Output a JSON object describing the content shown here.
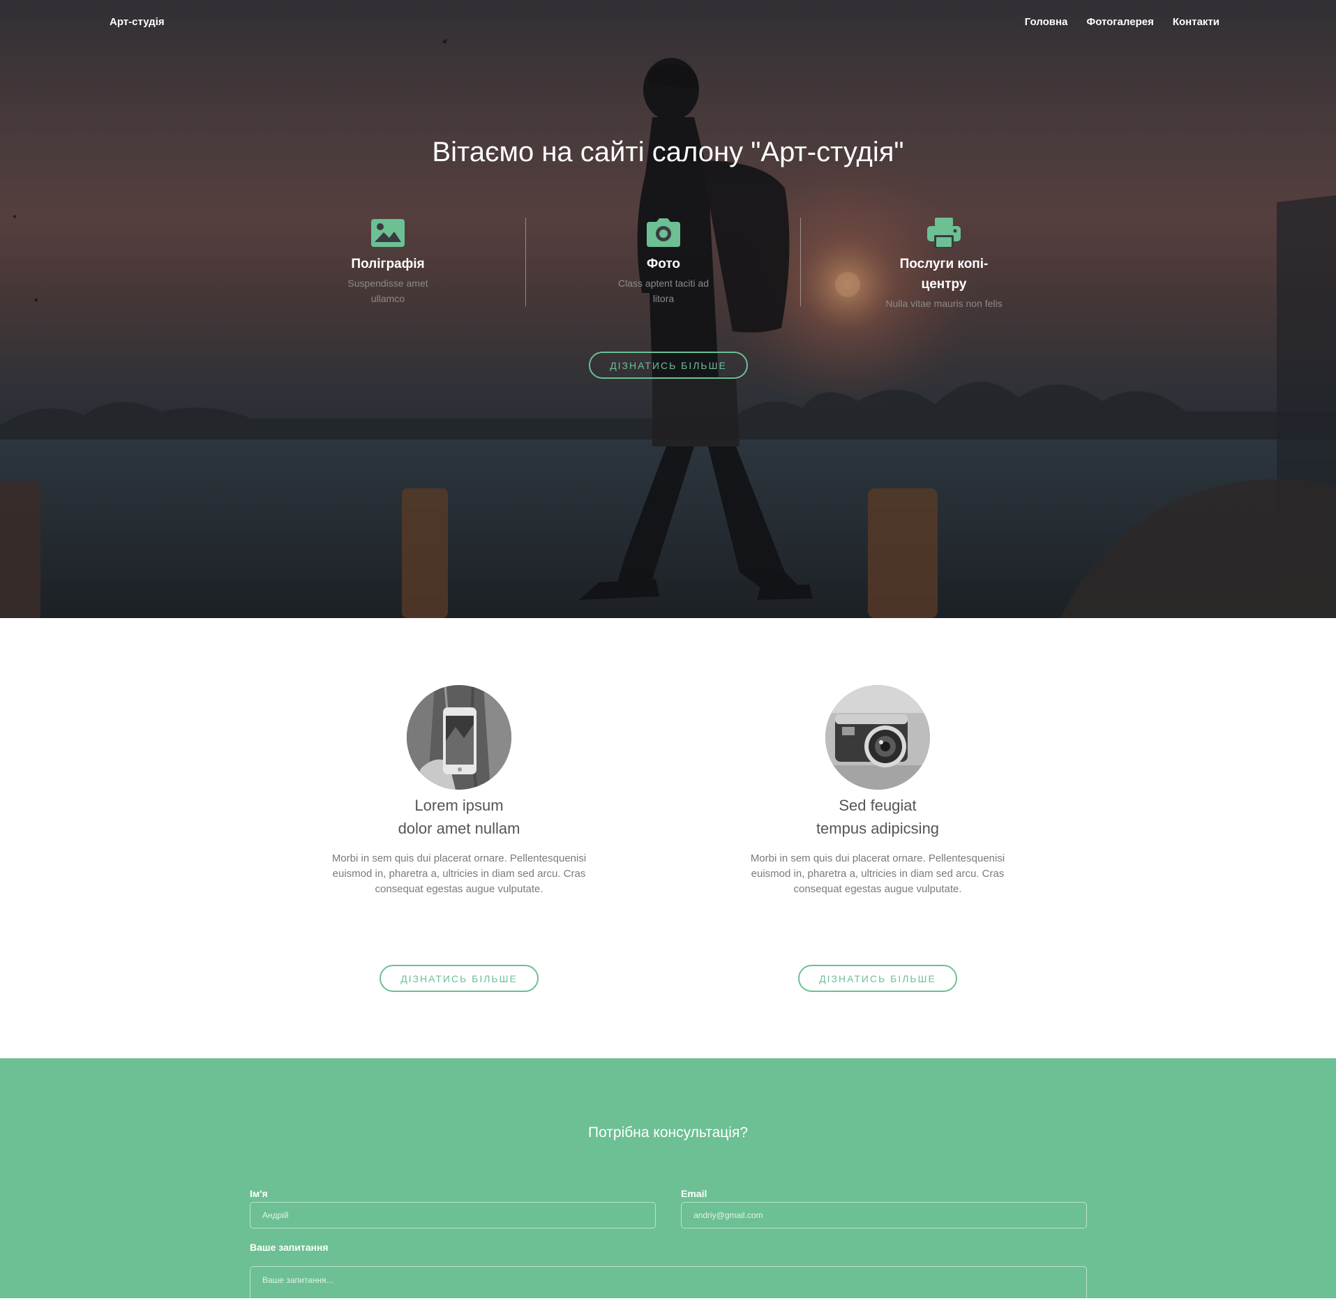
{
  "nav": {
    "brand": "Арт-студія",
    "links": [
      "Головна",
      "Фотогалерея",
      "Контакти"
    ]
  },
  "hero": {
    "title": "Вітаємо на сайті салону \"Арт-студія\"",
    "features": [
      {
        "icon": "image-icon",
        "title": "Поліграфія",
        "text": "Suspendisse amet ullamco"
      },
      {
        "icon": "camera-icon",
        "title": "Фото",
        "text": "Class aptent taciti ad litora"
      },
      {
        "icon": "printer-icon",
        "title": "Послуги копі-центру",
        "text": "Nulla vitae mauris non felis"
      }
    ],
    "button": "ДІЗНАТИСЬ БІЛЬШЕ"
  },
  "services": [
    {
      "image": "phone-photo",
      "title_line1": "Lorem ipsum",
      "title_line2": "dolor amet nullam",
      "text": "Morbi in sem quis dui placerat ornare. Pellentesquenisi euismod in, pharetra a, ultricies in diam sed arcu. Cras consequat egestas augue vulputate.",
      "button": "ДІЗНАТИСЬ БІЛЬШЕ"
    },
    {
      "image": "camera-photo",
      "title_line1": "Sed feugiat",
      "title_line2": "tempus adipicsing",
      "text": "Morbi in sem quis dui placerat ornare. Pellentesquenisi euismod in, pharetra a, ultricies in diam sed arcu. Cras consequat egestas augue vulputate.",
      "button": "ДІЗНАТИСЬ БІЛЬШЕ"
    }
  ],
  "contact": {
    "title": "Потрібна консультація?",
    "name_label": "Ім'я",
    "name_placeholder": "Андрій",
    "email_label": "Email",
    "email_placeholder": "andriy@gmail.com",
    "question_label": "Ваше запитання",
    "question_placeholder": "Ваше запитання..."
  },
  "colors": {
    "accent": "#6cc093",
    "hero_overlay": "#3b3a40",
    "text_dark": "#555555",
    "text_muted": "#7a7a7a"
  }
}
